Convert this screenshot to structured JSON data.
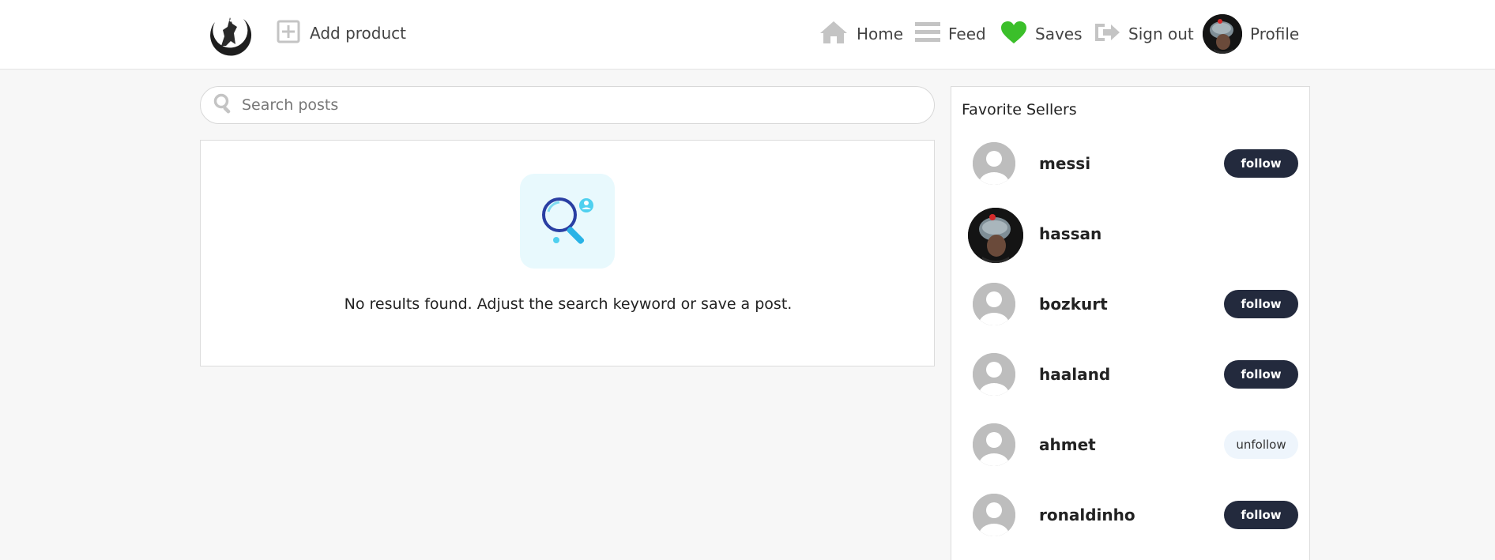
{
  "header": {
    "logo_icon": "wolf-moon-logo",
    "add_product_label": "Add product",
    "nav": {
      "home": "Home",
      "feed": "Feed",
      "saves": "Saves",
      "signout": "Sign out",
      "profile": "Profile"
    },
    "colors": {
      "saves_heart": "#3bbf2a",
      "icon_gray": "#c4c4c4"
    }
  },
  "search": {
    "placeholder": "Search posts",
    "value": ""
  },
  "results": {
    "empty_message": "No results found. Adjust the search keyword or save a post.",
    "illustration_icon": "magnifier-search-icon"
  },
  "sidebar": {
    "title": "Favorite Sellers",
    "sellers": [
      {
        "name": "messi",
        "action": "follow",
        "avatar": "default"
      },
      {
        "name": "hassan",
        "action": "",
        "avatar": "photo"
      },
      {
        "name": "bozkurt",
        "action": "follow",
        "avatar": "default"
      },
      {
        "name": "haaland",
        "action": "follow",
        "avatar": "default"
      },
      {
        "name": "ahmet",
        "action": "unfollow",
        "avatar": "default"
      },
      {
        "name": "ronaldinho",
        "action": "follow",
        "avatar": "default"
      }
    ]
  },
  "theme": {
    "button_dark": "#232a3d",
    "button_light": "#eef5fc",
    "page_bg": "#f7f7f7"
  }
}
